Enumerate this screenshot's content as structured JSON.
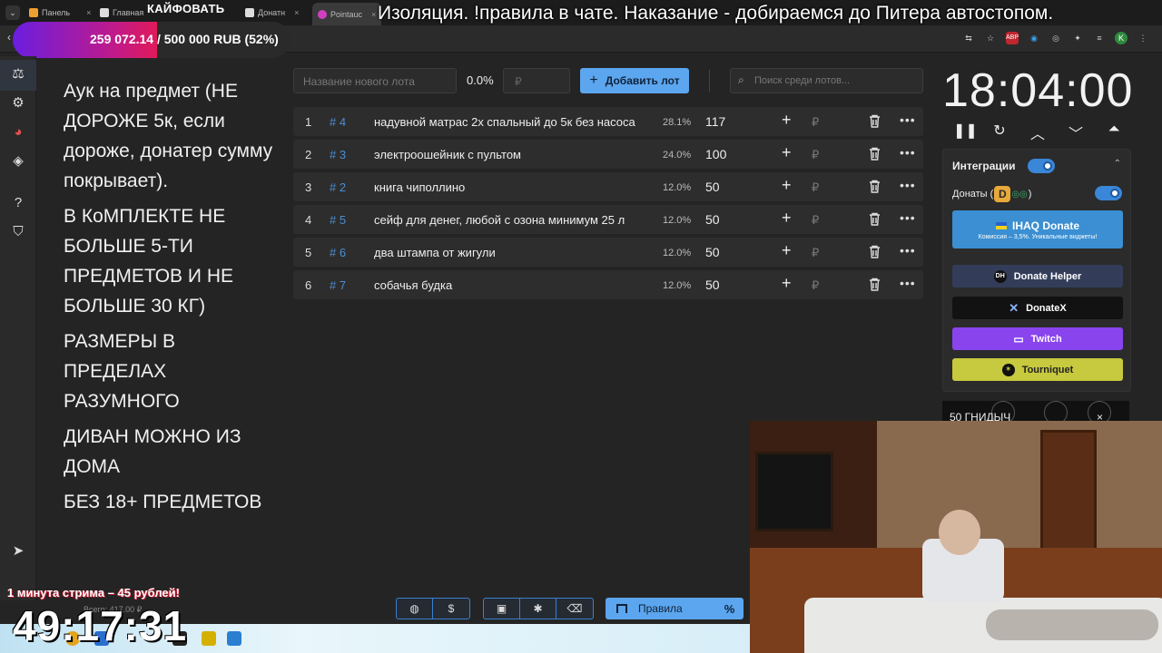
{
  "browser": {
    "tabs": [
      {
        "label": "Панель",
        "favicon_color": "#f0a030"
      },
      {
        "label": "Главная",
        "favicon_color": "#ffffff"
      },
      {
        "label": "Донатн",
        "favicon_color": "#ffffff"
      },
      {
        "label": "Pointauc",
        "favicon_color": "#d040c0"
      }
    ],
    "overlay_tab_text": "КАЙФОВАТЬ"
  },
  "banner_text": "Изоляция. !правила в чате. Наказание - добираемся до Питера автостопом.",
  "progress": {
    "text": "259 072.14 / 500 000 RUB (52%)",
    "percent": 52
  },
  "rules": {
    "paragraphs": [
      "Аук на предмет (НЕ ДОРОЖЕ 5к, если дороже, донатер сумму покрывает).",
      "В КоМПЛЕКТЕ НЕ БОЛЬШЕ 5-ТИ ПРЕДМЕТОВ И НЕ БОЛЬШЕ 30 КГ)",
      "РАЗМЕРЫ В ПРЕДЕЛАХ РАЗУМНОГО",
      "ДИВАН МОЖНО ИЗ ДОМА",
      "БЕЗ 18+ ПРЕДМЕТОВ"
    ]
  },
  "toolbar": {
    "lot_name_placeholder": "Название нового лота",
    "percent": "0.0%",
    "amount_placeholder": "₽",
    "add_button": "Добавить лот",
    "search_placeholder": "Поиск среди лотов..."
  },
  "lots": [
    {
      "num": "1",
      "id": "# 4",
      "name": "надувной матрас 2х спальный до 5к без насоса",
      "pct": "28.1%",
      "amount": "117"
    },
    {
      "num": "2",
      "id": "# 3",
      "name": "электроошейник с пультом",
      "pct": "24.0%",
      "amount": "100"
    },
    {
      "num": "3",
      "id": "# 2",
      "name": "книга чиполлино",
      "pct": "12.0%",
      "amount": "50"
    },
    {
      "num": "4",
      "id": "# 5",
      "name": "сейф для денег, любой с озона минимум 25 л",
      "pct": "12.0%",
      "amount": "50"
    },
    {
      "num": "5",
      "id": "# 6",
      "name": "два штампа от жигули",
      "pct": "12.0%",
      "amount": "50"
    },
    {
      "num": "6",
      "id": "# 7",
      "name": "собачья будка",
      "pct": "12.0%",
      "amount": "50"
    }
  ],
  "currency_symbol": "₽",
  "timer": "18:04:00",
  "integrations": {
    "title": "Интеграции",
    "donaty_label": "Донаты (",
    "donaty_suffix": ")",
    "ihaq_label": "IHAQ Donate",
    "ihaq_sub": "Комиссия – 3,5%. Уникальные виджеты!",
    "donate_helper": "Donate Helper",
    "donatex": "DonateX",
    "twitch": "Twitch",
    "tourniquet": "Tourniquet"
  },
  "donation_card": {
    "text": "50 ГНИДЫЧ",
    "close": "×"
  },
  "overlay": {
    "stream_minute": "1 минута стрима – 45 рублей!",
    "stream_timer": "49:17:31",
    "total": "Всего: 417.00 ₽"
  },
  "bottom": {
    "rules_label": "Правила",
    "rules_pct": "%"
  },
  "colors": {
    "accent": "#5ba6ee",
    "lot_id": "#4b8fd4",
    "twitch": "#8944ee",
    "tourniquet": "#c7c93e"
  }
}
